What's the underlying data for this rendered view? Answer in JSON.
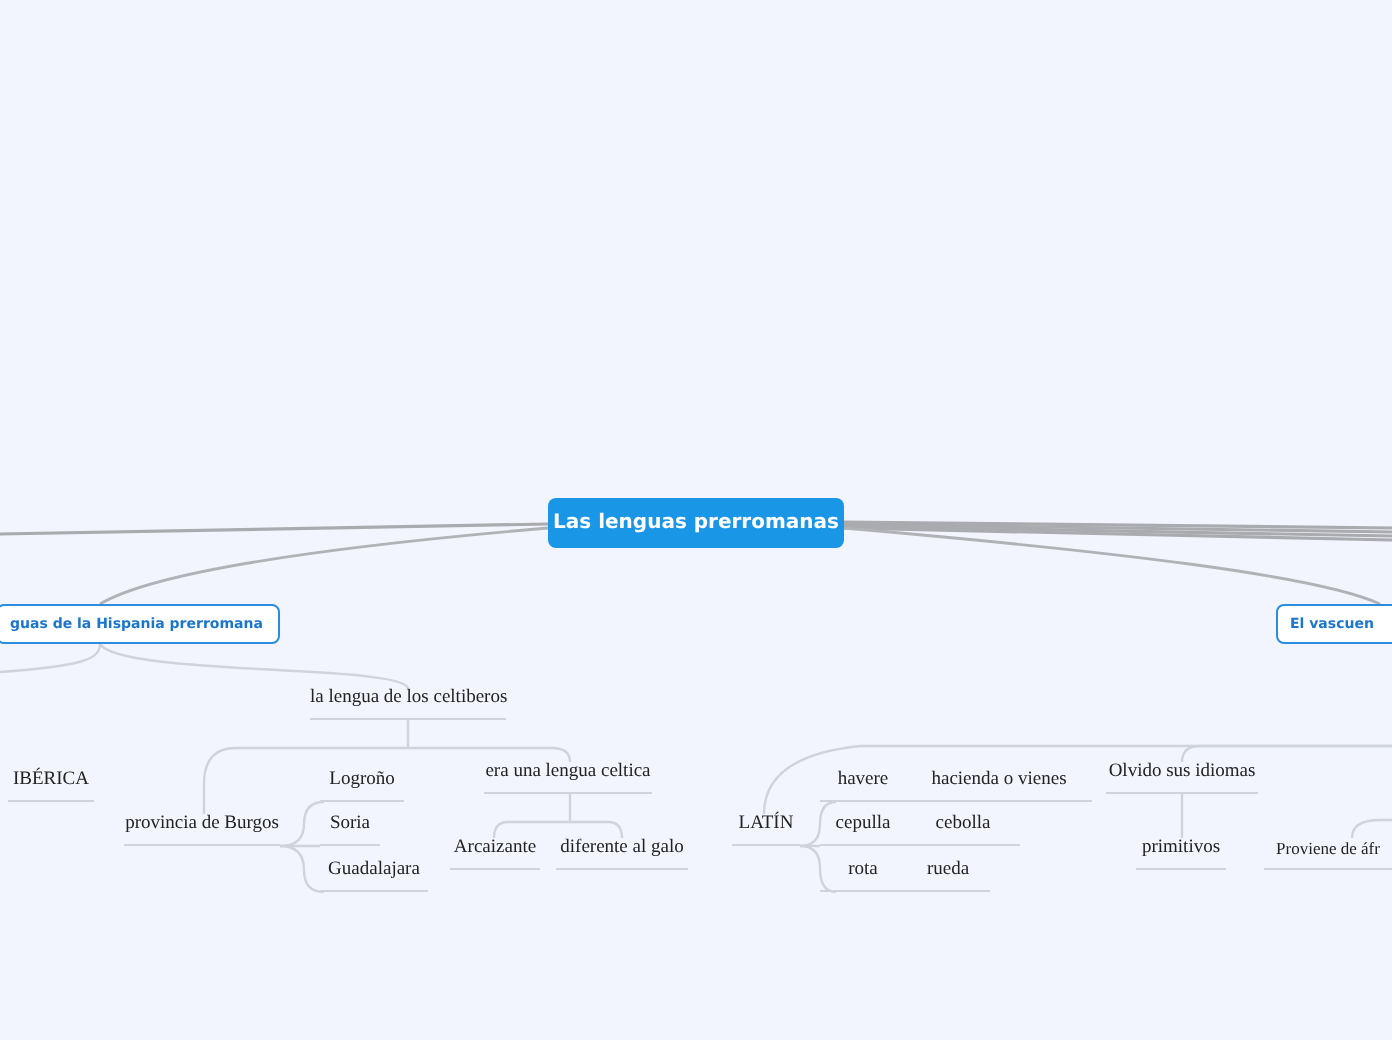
{
  "map": {
    "kind": "central",
    "text": "Las lenguas prerromanas",
    "children": [
      {
        "kind": "main",
        "text": "guas de la Hispania prerromana",
        "children": [
          {
            "kind": "subtopic",
            "text": "IBÉRICA"
          },
          {
            "kind": "subtopic",
            "text": "la lengua de los celtiberos",
            "children": [
              {
                "kind": "subtopic",
                "text": "provincia de Burgos",
                "children": [
                  {
                    "kind": "subtopic",
                    "text": "Logroño"
                  },
                  {
                    "kind": "subtopic",
                    "text": "Soria"
                  },
                  {
                    "kind": "subtopic",
                    "text": "Guadalajara"
                  }
                ]
              },
              {
                "kind": "subtopic",
                "text": "era una lengua celtica",
                "children": [
                  {
                    "kind": "subtopic",
                    "text": "Arcaizante"
                  },
                  {
                    "kind": "subtopic",
                    "text": "diferente al galo"
                  }
                ]
              }
            ]
          }
        ]
      },
      {
        "kind": "main",
        "text": "El vascuen",
        "children": [
          {
            "kind": "subtopic",
            "text": "LATÍN",
            "children": [
              {
                "kind": "subtopic",
                "text": "havere",
                "children": [
                  {
                    "kind": "subtopic",
                    "text": "hacienda o vienes"
                  }
                ]
              },
              {
                "kind": "subtopic",
                "text": "cepulla",
                "children": [
                  {
                    "kind": "subtopic",
                    "text": "cebolla"
                  }
                ]
              },
              {
                "kind": "subtopic",
                "text": "rota",
                "children": [
                  {
                    "kind": "subtopic",
                    "text": "rueda"
                  }
                ]
              }
            ]
          },
          {
            "kind": "subtopic",
            "text": "Olvido sus idiomas",
            "children": [
              {
                "kind": "subtopic",
                "text": "primitivos"
              }
            ]
          },
          {
            "kind": "subtopic",
            "text": "Proviene de áfr"
          }
        ]
      }
    ]
  }
}
